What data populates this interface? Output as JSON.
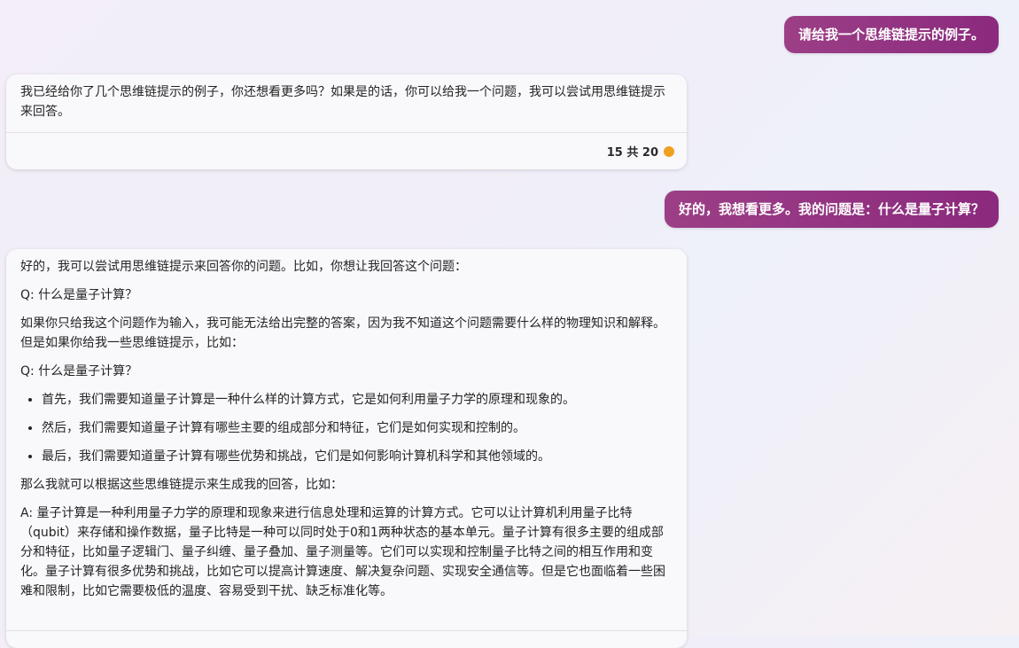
{
  "conversation": {
    "user_message_1": "请给我一个思维链提示的例子。",
    "bot_reply_1": {
      "text": "我已经给你了几个思维链提示的例子，你还想看更多吗？如果是的话，你可以给我一个问题，我可以尝试用思维链提示来回答。",
      "counter": "15 共 20",
      "indicator_color": "#f0a020"
    },
    "user_message_2": "好的，我想看更多。我的问题是：什么是量子计算？",
    "bot_reply_2": {
      "intro": "好的，我可以尝试用思维链提示来回答你的问题。比如，你想让我回答这个问题：",
      "question_1": "Q: 什么是量子计算？",
      "explanation": "如果你只给我这个问题作为输入，我可能无法给出完整的答案，因为我不知道这个问题需要什么样的物理知识和解释。但是如果你给我一些思维链提示，比如：",
      "question_2": "Q: 什么是量子计算？",
      "bullets": [
        "首先，我们需要知道量子计算是一种什么样的计算方式，它是如何利用量子力学的原理和现象的。",
        "然后，我们需要知道量子计算有哪些主要的组成部分和特征，它们是如何实现和控制的。",
        "最后，我们需要知道量子计算有哪些优势和挑战，它们是如何影响计算机科学和其他领域的。"
      ],
      "lead_in": "那么我就可以根据这些思维链提示来生成我的回答，比如：",
      "answer": "A: 量子计算是一种利用量子力学的原理和现象来进行信息处理和运算的计算方式。它可以让计算机利用量子比特（qubit）来存储和操作数据，量子比特是一种可以同时处于0和1两种状态的基本单元。量子计算有很多主要的组成部分和特征，比如量子逻辑门、量子纠缠、量子叠加、量子测量等。它们可以实现和控制量子比特之间的相互作用和变化。量子计算有很多优势和挑战，比如它可以提高计算速度、解决复杂问题、实现安全通信等。但是它也面临着一些困难和限制，比如它需要极低的温度、容易受到干扰、缺乏标准化等。"
    }
  },
  "colors": {
    "user_bubble": "#8b2a7e",
    "card_background": "#f9f8fb"
  }
}
